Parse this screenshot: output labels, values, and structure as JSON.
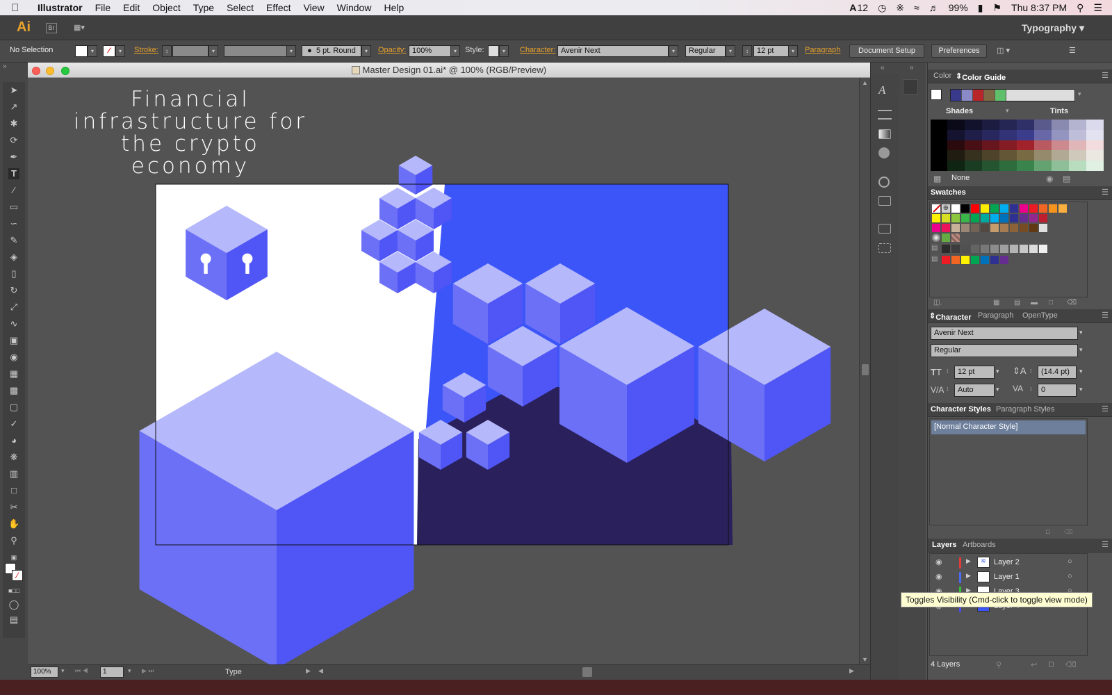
{
  "menubar": {
    "app_name": "Illustrator",
    "items": [
      "File",
      "Edit",
      "Object",
      "Type",
      "Select",
      "Effect",
      "View",
      "Window",
      "Help"
    ],
    "status": {
      "adobe": "12",
      "battery": "99%",
      "clock": "Thu 8:37 PM"
    }
  },
  "appbar": {
    "logo": "Ai",
    "bridge": "Br",
    "workspace": "Typography"
  },
  "control": {
    "selection": "No Selection",
    "stroke_label": "Stroke:",
    "brush": "5 pt. Round",
    "opacity_label": "Opacity:",
    "opacity_value": "100%",
    "style_label": "Style:",
    "character_label": "Character:",
    "font": "Avenir Next",
    "font_style": "Regular",
    "font_size": "12 pt",
    "paragraph_label": "Paragraph",
    "document_setup": "Document Setup",
    "preferences": "Preferences"
  },
  "document": {
    "title": "Master Design 01.ai* @ 100% (RGB/Preview)",
    "headline": [
      "Financial",
      "infrastructure for",
      "the crypto economy"
    ]
  },
  "status": {
    "zoom": "100%",
    "artboard": "1",
    "tool": "Type"
  },
  "color_panel": {
    "tabs": [
      "Color",
      "Color Guide"
    ],
    "shades": "Shades",
    "tints": "Tints",
    "none": "None",
    "harmony_colors": [
      "#3a3a8c",
      "#8a8ac8",
      "#b8262a",
      "#7d6a45",
      "#5fbf6a"
    ],
    "rows": [
      [
        "#0a0a18",
        "#12122c",
        "#1c1c40",
        "#262654",
        "#303068",
        "#5a5a8c",
        "#8a8ab0",
        "#b4b4d0",
        "#dadaec"
      ],
      [
        "#141430",
        "#1e1e48",
        "#28285e",
        "#323276",
        "#3c3c8c",
        "#6868a8",
        "#9494c0",
        "#bebed8",
        "#e2e2f0"
      ],
      [
        "#2a0a0c",
        "#481014",
        "#66161c",
        "#841c24",
        "#a2222c",
        "#b85a60",
        "#cc8a8e",
        "#e0b6b8",
        "#f2dcdd"
      ],
      [
        "#201c12",
        "#36301e",
        "#4c432a",
        "#625636",
        "#786a42",
        "#958a6c",
        "#b2a994",
        "#cfc9bc",
        "#ebe8e2"
      ],
      [
        "#102414",
        "#1a3c22",
        "#245430",
        "#2e6c3e",
        "#38844c",
        "#64a272",
        "#8ebf98",
        "#b8dcbe",
        "#e0f0e2"
      ]
    ]
  },
  "swatches": {
    "title": "Swatches",
    "row1": [
      "#ffffff",
      "#000000",
      "#ff0000",
      "#ffee00",
      "#00a651",
      "#00aeef",
      "#2e3192",
      "#ec008c",
      "#ed1c24",
      "#f26522",
      "#f7941d",
      "#fbaf3f"
    ],
    "row2": [
      "#fff200",
      "#d7df23",
      "#8dc63f",
      "#39b54a",
      "#00a651",
      "#00a99d",
      "#00aeef",
      "#0072bc",
      "#2e3192",
      "#662d91",
      "#92278f",
      "#be1e2d"
    ],
    "row3": [
      "#ec008c",
      "#ed145b",
      "#c7b299",
      "#998675",
      "#736357",
      "#534741",
      "#c69c6d",
      "#a67c52",
      "#8c6239",
      "#754c24",
      "#603913",
      "#e0e0e0"
    ],
    "grays": [
      "#2b2b2b",
      "#3d3d3d",
      "#505050",
      "#646464",
      "#787878",
      "#8c8c8c",
      "#a0a0a0",
      "#b4b4b4",
      "#c8c8c8",
      "#dcdcdc",
      "#f0f0f0"
    ],
    "brights": [
      "#ed1c24",
      "#f26522",
      "#fff200",
      "#00a651",
      "#0072bc",
      "#2e3192",
      "#662d91"
    ]
  },
  "character_panel": {
    "tabs": [
      "Character",
      "Paragraph",
      "OpenType"
    ],
    "font": "Avenir Next",
    "style": "Regular",
    "size": "12 pt",
    "leading": "(14.4 pt)",
    "kerning": "Auto",
    "tracking": "0"
  },
  "styles_panel": {
    "tabs": [
      "Character Styles",
      "Paragraph Styles"
    ],
    "item": "[Normal Character Style]"
  },
  "layers_panel": {
    "tabs": [
      "Layers",
      "Artboards"
    ],
    "layers": [
      {
        "name": "Layer 2",
        "color": "#e23b3b"
      },
      {
        "name": "Layer 1",
        "color": "#4b6cf0"
      },
      {
        "name": "Layer 3",
        "color": "#3bbf3b"
      },
      {
        "name": "Layer 4",
        "color": "#4b4bf0"
      }
    ],
    "count": "4 Layers",
    "tooltip": "Toggles Visibility (Cmd-click to toggle view mode)"
  }
}
